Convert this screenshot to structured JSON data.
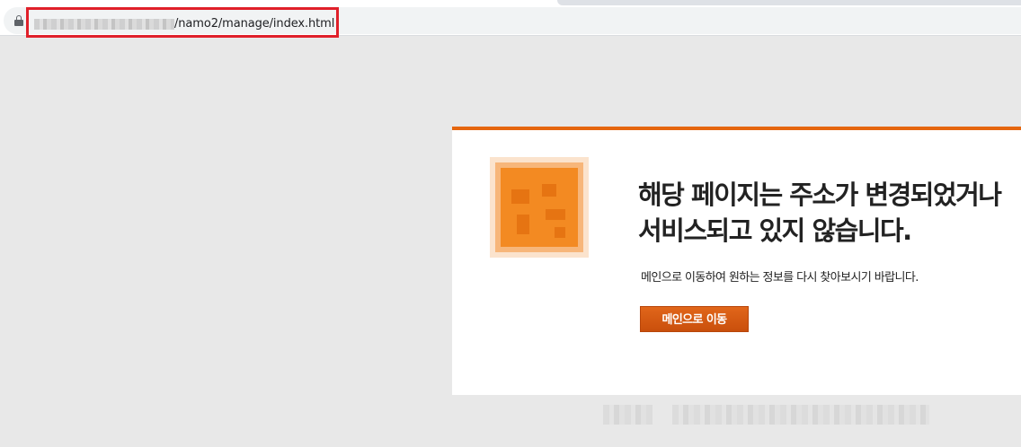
{
  "browser": {
    "url_host": "",
    "url_path": "/namo2/manage/index.html",
    "icons": {
      "lock": "lock-icon"
    },
    "colors": {
      "highlight": "#e0202a"
    }
  },
  "error_page": {
    "title_line1": "해당 페이지는 주소가 변경되었거나",
    "title_line2": "서비스되고 있지 않습니다.",
    "description": "메인으로 이동하여 원하는 정보를 다시 찾아보시기 바랍니다.",
    "main_button_label": "메인으로 이동",
    "colors": {
      "accent": "#e5660f",
      "button": "#d45a12"
    }
  }
}
